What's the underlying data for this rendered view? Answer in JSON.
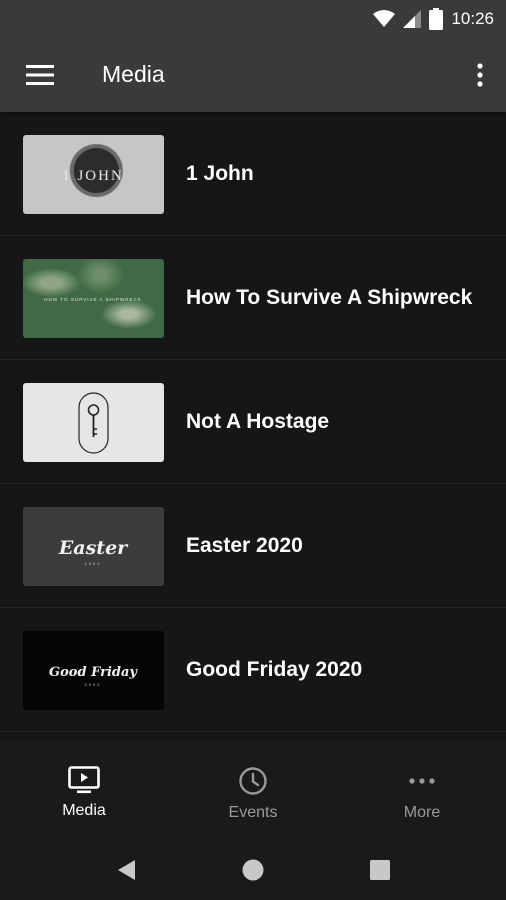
{
  "status": {
    "time": "10:26"
  },
  "appbar": {
    "title": "Media"
  },
  "media_items": [
    {
      "title": "1 John",
      "thumb_text": "1 JOHN"
    },
    {
      "title": "How To Survive A Shipwreck",
      "thumb_text": "HOW TO SURVIVE A SHIPWRECK"
    },
    {
      "title": "Not A Hostage",
      "thumb_text": ""
    },
    {
      "title": "Easter 2020",
      "thumb_text": "Easter",
      "thumb_sub": "2020"
    },
    {
      "title": "Good Friday 2020",
      "thumb_text": "Good Friday",
      "thumb_sub": "2020"
    }
  ],
  "bottom_nav": [
    {
      "label": "Media",
      "icon": "tv-play-icon",
      "active": true
    },
    {
      "label": "Events",
      "icon": "clock-icon",
      "active": false
    },
    {
      "label": "More",
      "icon": "more-horizontal-icon",
      "active": false
    }
  ],
  "colors": {
    "appbar": "#3a3a3a",
    "background": "#161618",
    "active": "#ffffff",
    "inactive": "#9a9a9a"
  }
}
